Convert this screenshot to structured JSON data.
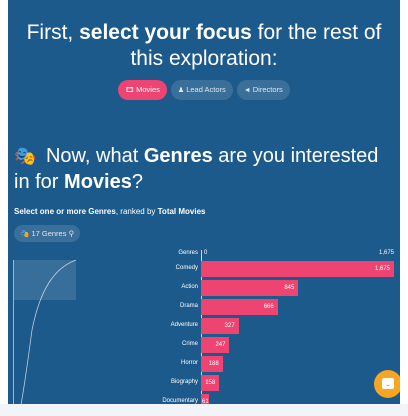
{
  "header": {
    "prefix": "First, ",
    "bold": "select your focus",
    "suffix": " for the rest of this exploration:"
  },
  "focus_options": [
    {
      "icon": "film-icon",
      "label": "Movies",
      "active": true
    },
    {
      "icon": "person-icon",
      "label": "Lead Actors",
      "active": false
    },
    {
      "icon": "megaphone-icon",
      "label": "Directors",
      "active": false
    }
  ],
  "question": {
    "emoji": "🎭",
    "part1": " Now, what ",
    "bold1": "Genres",
    "part2": " are you interested in for ",
    "bold2": "Movies",
    "part3": "?"
  },
  "subtitle": {
    "text1": "Select one or more Genres",
    "text2": ", ranked by ",
    "text3": "Total Movies"
  },
  "genre_chip": {
    "icon": "masks-icon",
    "label": "17 Genres",
    "search_icon": "search-icon"
  },
  "chart_data": {
    "type": "bar",
    "title": "",
    "axis_label": "Genres",
    "axis_min": "0",
    "axis_max": "1,675",
    "xlim": [
      0,
      1675
    ],
    "categories": [
      "Comedy",
      "Action",
      "Drama",
      "Adventure",
      "Crime",
      "Horror",
      "Biography",
      "Documentary"
    ],
    "values": [
      1675,
      845,
      666,
      327,
      247,
      188,
      158,
      61
    ],
    "value_labels": [
      "1,675",
      "845",
      "666",
      "327",
      "247",
      "188",
      "158",
      "61"
    ],
    "bar_color": "#ee4472"
  },
  "chat_widget": {
    "icon": "chat-icon"
  }
}
